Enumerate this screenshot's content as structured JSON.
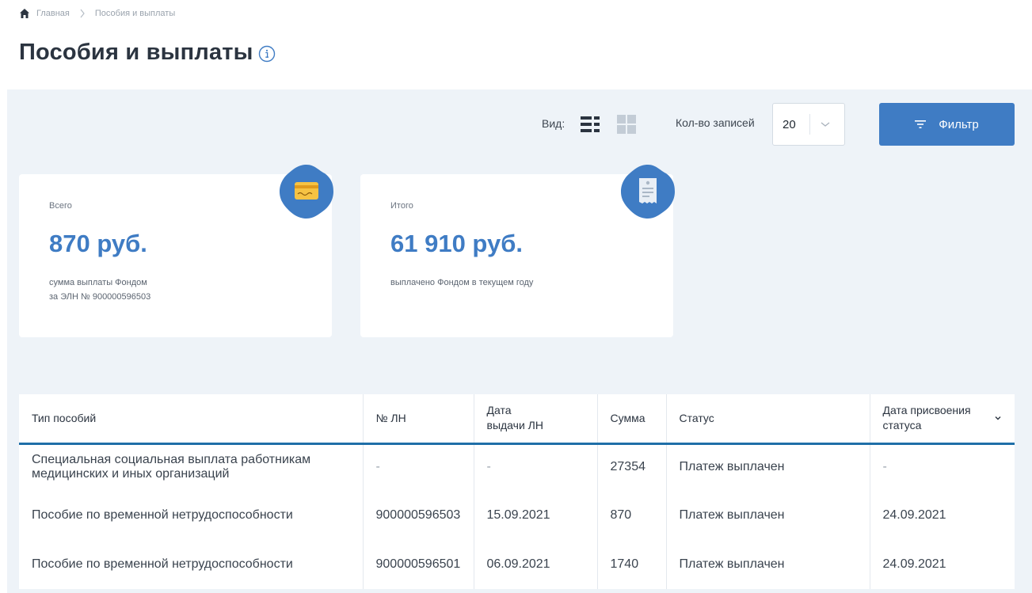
{
  "breadcrumb": {
    "home": "Главная",
    "current": "Пособия и выплаты"
  },
  "page": {
    "title": "Пособия и выплаты"
  },
  "toolbar": {
    "view_label": "Вид:",
    "records_label": "Кол-во записей",
    "records_value": "20",
    "filter_label": "Фильтр"
  },
  "cards": [
    {
      "label": "Всего",
      "amount": "870 руб.",
      "desc_line1": "сумма выплаты Фондом",
      "desc_line2": "за ЭЛН № 900000596503",
      "icon": "credit-card-icon"
    },
    {
      "label": "Итого",
      "amount": "61 910 руб.",
      "desc_line1": "выплачено Фондом в текущем году",
      "desc_line2": "",
      "icon": "receipt-icon"
    }
  ],
  "table": {
    "headers": {
      "type": "Тип пособий",
      "ln": "№ ЛН",
      "date_issue_1": "Дата",
      "date_issue_2": "выдачи ЛН",
      "sum": "Сумма",
      "status": "Статус",
      "status_date_1": "Дата присвоения",
      "status_date_2": "статуса"
    },
    "rows": [
      {
        "type_1": "Специальная социальная выплата работникам",
        "type_2": "медицинских и иных организаций",
        "ln": "-",
        "date_issue": "-",
        "sum": "27354",
        "status": "Платеж выплачен",
        "status_date": "-"
      },
      {
        "type_1": "Пособие по временной нетрудоспособности",
        "type_2": "",
        "ln": "900000596503",
        "date_issue": "15.09.2021",
        "sum": "870",
        "status": "Платеж выплачен",
        "status_date": "24.09.2021"
      },
      {
        "type_1": "Пособие по временной нетрудоспособности",
        "type_2": "",
        "ln": "900000596501",
        "date_issue": "06.09.2021",
        "sum": "1740",
        "status": "Платеж выплачен",
        "status_date": "24.09.2021"
      }
    ]
  },
  "colors": {
    "accent": "#3f7cc4",
    "panel_bg": "#eef3f8",
    "header_rule": "#1f6fa8"
  }
}
